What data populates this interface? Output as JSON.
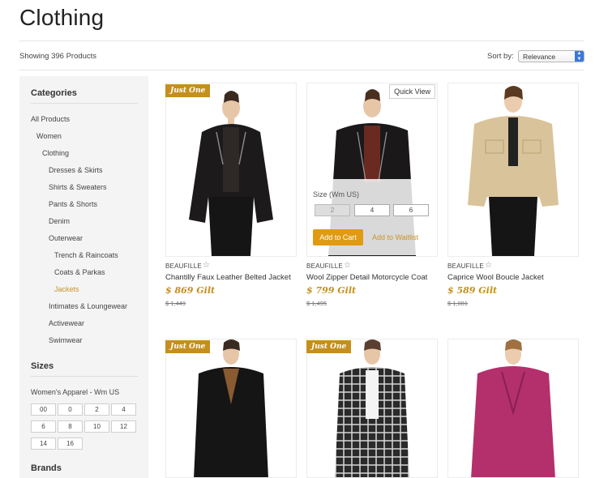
{
  "page": {
    "title": "Clothing"
  },
  "toolbar": {
    "count": "Showing 396 Products",
    "sort_label": "Sort by:",
    "sort_value": "Relevance"
  },
  "sidebar": {
    "categories_heading": "Categories",
    "categories": [
      {
        "label": "All Products"
      },
      {
        "label": "Women"
      },
      {
        "label": "Clothing"
      },
      {
        "label": "Dresses & Skirts"
      },
      {
        "label": "Shirts & Sweaters"
      },
      {
        "label": "Pants & Shorts"
      },
      {
        "label": "Denim"
      },
      {
        "label": "Outerwear"
      },
      {
        "label": "Trench & Raincoats"
      },
      {
        "label": "Coats & Parkas"
      },
      {
        "label": "Jackets",
        "active": true
      },
      {
        "label": "Intimates & Loungewear"
      },
      {
        "label": "Activewear"
      },
      {
        "label": "Swimwear"
      }
    ],
    "sizes_heading": "Sizes",
    "sizes_group": "Women's Apparel - Wm US",
    "sizes": [
      "00",
      "0",
      "2",
      "4",
      "6",
      "8",
      "10",
      "12",
      "14",
      "16"
    ],
    "brands_heading": "Brands"
  },
  "products": [
    {
      "badge": "Just One",
      "brand": "BEAUFILLE",
      "name": "Chantilly Faux Leather Belted Jacket",
      "price": "$ 869 Gilt",
      "old_price": "$ 1,449",
      "garment_color": "#1c1a1a",
      "icon": "star-icon"
    },
    {
      "quick_view": "Quick View",
      "brand": "BEAUFILLE",
      "name": "Wool Zipper Detail Motorcycle Coat",
      "price": "$ 799 Gilt",
      "old_price": "$ 1,495",
      "garment_color": "#1a1818",
      "icon": "star-icon",
      "overlay": {
        "label": "Size (Wm US)",
        "sizes": [
          "2",
          "4",
          "6"
        ],
        "unavailable": [
          "2"
        ],
        "add_to_cart": "Add to Cart",
        "waitlist": "Add to Waitlist"
      }
    },
    {
      "brand": "BEAUFILLE",
      "name": "Caprice Wool Boucle Jacket",
      "price": "$ 589 Gilt",
      "old_price": "$ 1,081",
      "garment_color": "#d9c39a",
      "icon": "star-icon"
    },
    {
      "badge": "Just One",
      "garment_color": "#151515"
    },
    {
      "badge": "Just One",
      "garment_color": "#2a2a2a"
    },
    {
      "garment_color": "#b3306c"
    }
  ],
  "colors": {
    "accent": "#c48f1d",
    "button": "#e09b12",
    "link_active": "#c8922a",
    "select_arrow": "#3b79d8"
  }
}
